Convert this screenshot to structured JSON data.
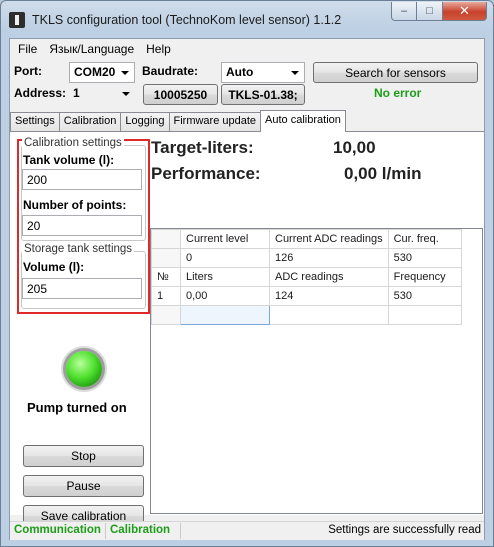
{
  "window": {
    "title": "TKLS configuration tool (TechnoKom level sensor) 1.1.2"
  },
  "menu": [
    "File",
    "Язык/Language",
    "Help"
  ],
  "connection": {
    "port_label": "Port:",
    "port_value": "COM20",
    "baud_label": "Baudrate:",
    "baud_value": "Auto",
    "search_button": "Search for sensors",
    "address_label": "Address:",
    "address_value": "1",
    "serial": "10005250",
    "firmware": "TKLS-01.38;",
    "status": "No error",
    "status_color": "#1c9e17"
  },
  "tabs": [
    "Settings",
    "Calibration",
    "Logging",
    "Firmware update",
    "Auto calibration"
  ],
  "active_tab": "Auto calibration",
  "calibration_settings": {
    "title": "Calibration settings",
    "tank_volume_label": "Tank volume (l):",
    "tank_volume": "200",
    "points_label": "Number of points:",
    "points": "20"
  },
  "storage_settings": {
    "title": "Storage tank settings",
    "volume_label": "Volume (l):",
    "volume": "205"
  },
  "pump": {
    "status": "Pump turned on",
    "led_color": "#43d92a"
  },
  "controls": {
    "stop": "Stop",
    "pause": "Pause",
    "save": "Save calibration"
  },
  "readout": {
    "target_label": "Target-liters:",
    "target_value": "10,00",
    "performance_label": "Performance:",
    "performance_value": "0,00 l/min"
  },
  "grid": {
    "current_headers": [
      "",
      "Current level",
      "Current ADC readings",
      "Cur. freq."
    ],
    "current_values": [
      "",
      "0",
      "126",
      "530"
    ],
    "headers": [
      "№",
      "Liters",
      "ADC readings",
      "Frequency"
    ],
    "rows": [
      [
        "1",
        "0,00",
        "124",
        "530"
      ]
    ]
  },
  "statusbar": {
    "communication": "Communication",
    "calibration": "Calibration",
    "message": "Settings are successfully read",
    "indicator_color": "#1c9e17"
  }
}
